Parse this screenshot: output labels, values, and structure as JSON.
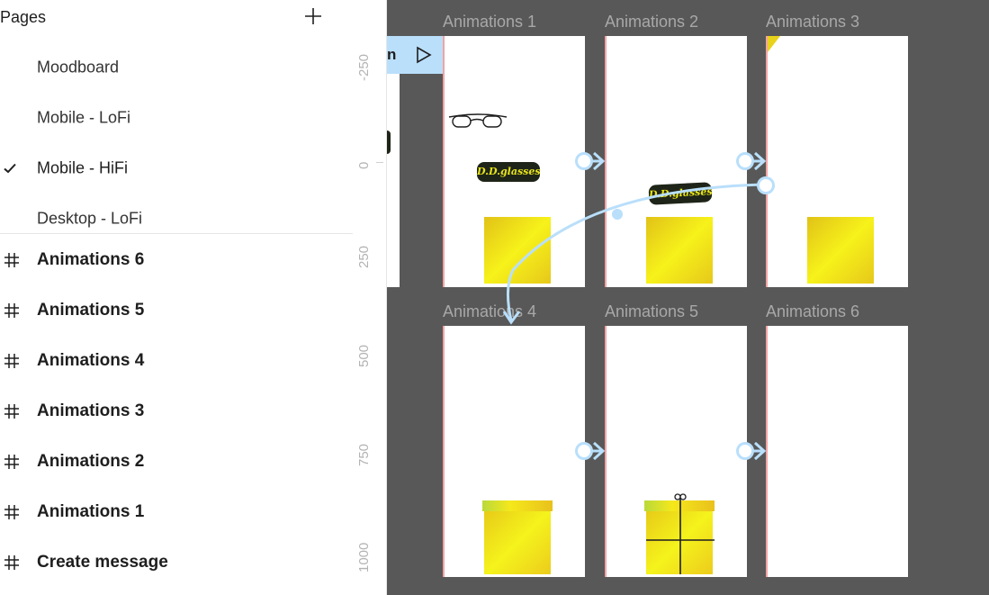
{
  "pages_panel": {
    "title": "Pages",
    "add_icon": "plus-icon",
    "pages": [
      {
        "label": "Moodboard",
        "selected": false
      },
      {
        "label": "Mobile - LoFi",
        "selected": false
      },
      {
        "label": "Mobile - HiFi",
        "selected": true
      },
      {
        "label": "Desktop - LoFi",
        "selected": false
      }
    ]
  },
  "layers": [
    {
      "label": "Animations 6",
      "icon": "frame-hash-icon"
    },
    {
      "label": "Animations 5",
      "icon": "frame-hash-icon"
    },
    {
      "label": "Animations 4",
      "icon": "frame-hash-icon"
    },
    {
      "label": "Animations 3",
      "icon": "frame-hash-icon"
    },
    {
      "label": "Animations 2",
      "icon": "frame-hash-icon"
    },
    {
      "label": "Animations 1",
      "icon": "frame-hash-icon"
    },
    {
      "label": "Create message",
      "icon": "frame-hash-icon"
    }
  ],
  "ruler": {
    "labels": [
      "-250",
      "0",
      "250",
      "500",
      "750",
      "1000"
    ]
  },
  "canvas": {
    "background": "#585858",
    "play_chip": {
      "text": "n",
      "icon": "play-icon"
    },
    "frames": [
      {
        "label": "Animations 1"
      },
      {
        "label": "Animations 2"
      },
      {
        "label": "Animations 3"
      },
      {
        "label": "Animations 4"
      },
      {
        "label": "Animations 5"
      },
      {
        "label": "Animations 6"
      }
    ],
    "badge_text": "D.D.glasses",
    "prototype_connection_color": "#b9dffb"
  }
}
